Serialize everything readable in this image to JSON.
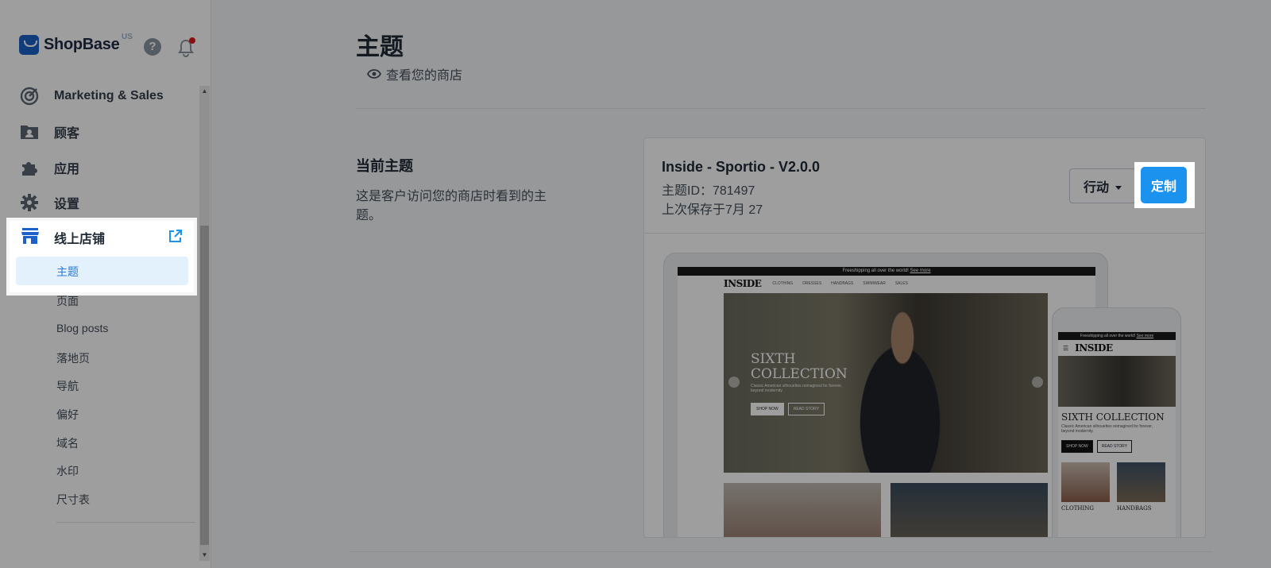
{
  "brand": {
    "name": "ShopBase",
    "region": "US"
  },
  "header_icons": {
    "help": "help-icon",
    "notification": "bell-icon",
    "notification_color": "#e0171b"
  },
  "sidebar": {
    "items": [
      {
        "label": "Marketing & Sales",
        "icon": "target-icon"
      },
      {
        "label": "顾客",
        "icon": "customer-folder-icon"
      },
      {
        "label": "应用",
        "icon": "puzzle-icon"
      },
      {
        "label": "设置",
        "icon": "gear-icon"
      }
    ],
    "online_store": {
      "label": "线上店铺",
      "icon": "store-icon",
      "external_icon": "external-link-icon",
      "active_sub": "主题",
      "sub_items": [
        "页面",
        "Blog posts",
        "落地页",
        "导航",
        "偏好",
        "域名",
        "水印",
        "尺寸表"
      ]
    }
  },
  "main": {
    "title": "主题",
    "view_store": "查看您的商店",
    "current_theme_section": {
      "title": "当前主题",
      "description": "这是客户访问您的商店时看到的主题。"
    },
    "theme_card": {
      "name": "Inside - Sportio - V2.0.0",
      "id_line": "主题ID：781497",
      "saved_line": "上次保存于7月 27",
      "action_label": "行动",
      "customize_label": "定制"
    },
    "preview": {
      "shipping_text": "Freeshipping all over the world!",
      "shipping_link": "See more",
      "site_logo": "INSIDE",
      "site_menu": [
        "CLOTHING",
        "DRESSES",
        "HANDBAGS",
        "SWIMWEAR",
        "SALES"
      ],
      "hero_title_line1": "SIXTH",
      "hero_title_line2": "COLLECTION",
      "hero_subtitle": "Classic American silhouettes reimagined for forever, beyond modernity.",
      "hero_btn_primary": "SHOP NOW",
      "hero_btn_secondary": "READ STORY",
      "mobile_title": "SIXTH COLLECTION",
      "tile1": "CLOTHING",
      "tile2": "HANDBAGS"
    }
  },
  "colors": {
    "accent": "#1c92ef",
    "active_sub_bg": "#e3f1fd",
    "active_sub_text": "#2c7ad6"
  }
}
